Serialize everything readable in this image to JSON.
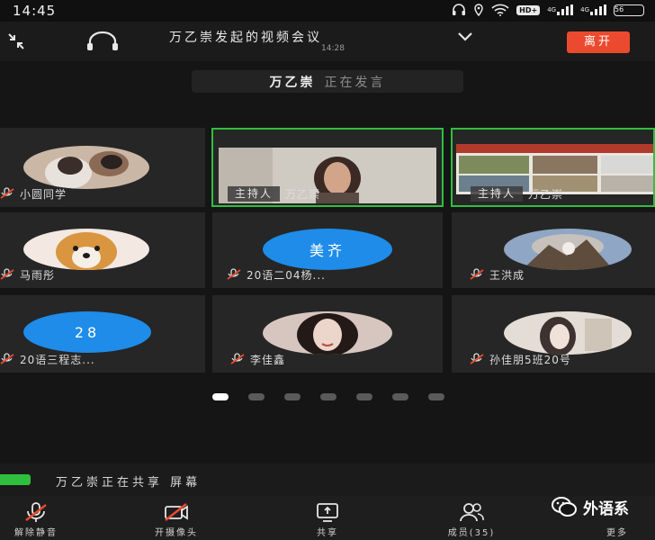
{
  "status_bar": {
    "time": "14:45",
    "hd_badge": "HD+",
    "signal_1": "4G",
    "signal_2": "4G",
    "battery": "56"
  },
  "header": {
    "title": "万乙崇发起的视频会议",
    "subtitle_time": "14:28",
    "leave_label": "离开"
  },
  "speaker": {
    "name": "万乙崇",
    "status": "正在发言"
  },
  "participants": [
    {
      "name": "小圆同学",
      "avatar": "photo",
      "muted": true
    },
    {
      "name": "万乙崇",
      "host_tag": "主持人",
      "avatar": "video",
      "active": true
    },
    {
      "name": "万乙崇",
      "host_tag": "主持人",
      "avatar": "screen-share",
      "active": true
    },
    {
      "name": "马雨彤",
      "avatar": "photo",
      "muted": true
    },
    {
      "name": "20语二04杨...",
      "avatar_text": "美齐",
      "avatar": "text",
      "muted": true
    },
    {
      "name": "王洪成",
      "avatar": "photo",
      "muted": true
    },
    {
      "name": "20语三程志...",
      "avatar_text": "28",
      "avatar": "text",
      "muted": true
    },
    {
      "name": "李佳鑫",
      "avatar": "photo",
      "muted": true
    },
    {
      "name": "孙佳朋5班20号",
      "avatar": "photo",
      "muted": true
    }
  ],
  "pagination": {
    "pages": 7,
    "current": 1
  },
  "sharing": {
    "text": "万乙崇正在共享 屏幕"
  },
  "toolbar": {
    "unmute": "解除静音",
    "camera": "开摄像头",
    "share": "共享",
    "members": "成员(35)",
    "more": "更多"
  },
  "watermark": {
    "text": "外语系"
  },
  "colors": {
    "accent_red": "#ec4a2e",
    "active_green": "#2fbf3f",
    "avatar_blue": "#1e8ce8"
  }
}
